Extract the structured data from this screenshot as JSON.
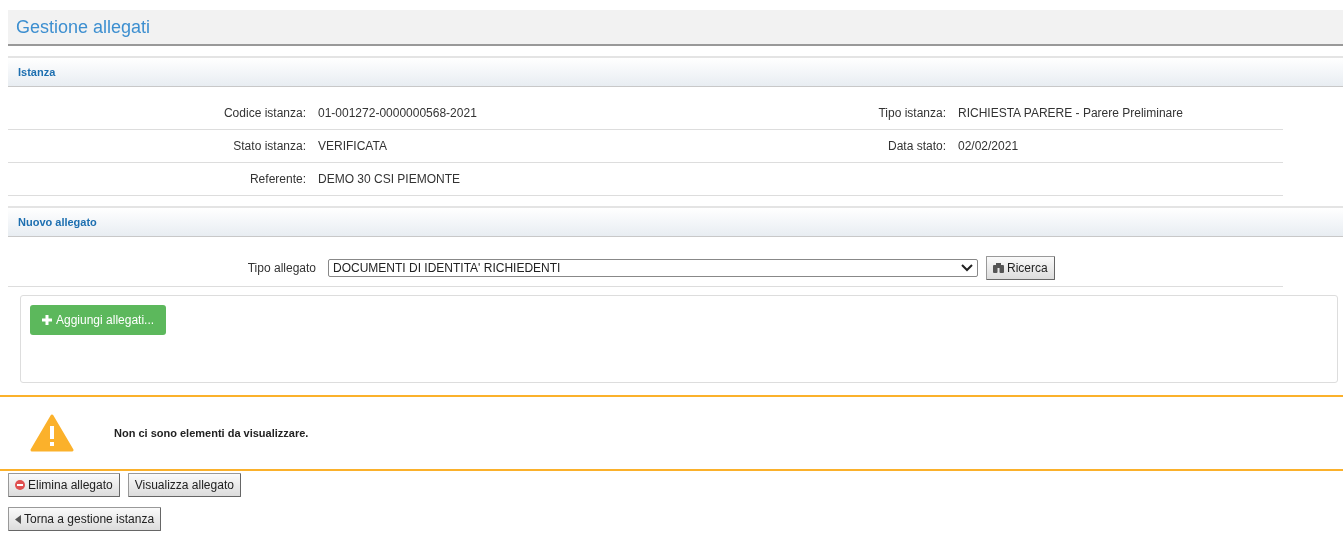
{
  "title": "Gestione allegati",
  "istanza": {
    "title": "Istanza",
    "rows": [
      [
        {
          "label": "Codice istanza:",
          "value": "01-001272-0000000568-2021"
        },
        {
          "label": "Tipo istanza:",
          "value": "RICHIESTA PARERE - Parere Preliminare"
        }
      ],
      [
        {
          "label": "Stato istanza:",
          "value": "VERIFICATA"
        },
        {
          "label": "Data stato:",
          "value": "02/02/2021"
        }
      ],
      [
        {
          "label": "Referente:",
          "value": "DEMO 30 CSI PIEMONTE"
        }
      ]
    ]
  },
  "nuovo_allegato": {
    "title": "Nuovo allegato",
    "tipo_label": "Tipo allegato",
    "tipo_value": "DOCUMENTI DI IDENTITA' RICHIEDENTI",
    "search_button": "Ricerca",
    "add_button": "Aggiungi allegati..."
  },
  "message": {
    "kind": "warning",
    "text": "Non ci sono elementi da visualizzare."
  },
  "actions": [
    {
      "label": "Elimina allegato",
      "kind": "delete"
    },
    {
      "label": "Visualizza allegato",
      "kind": "plain"
    }
  ],
  "back_button": "Torna a gestione istanza"
}
